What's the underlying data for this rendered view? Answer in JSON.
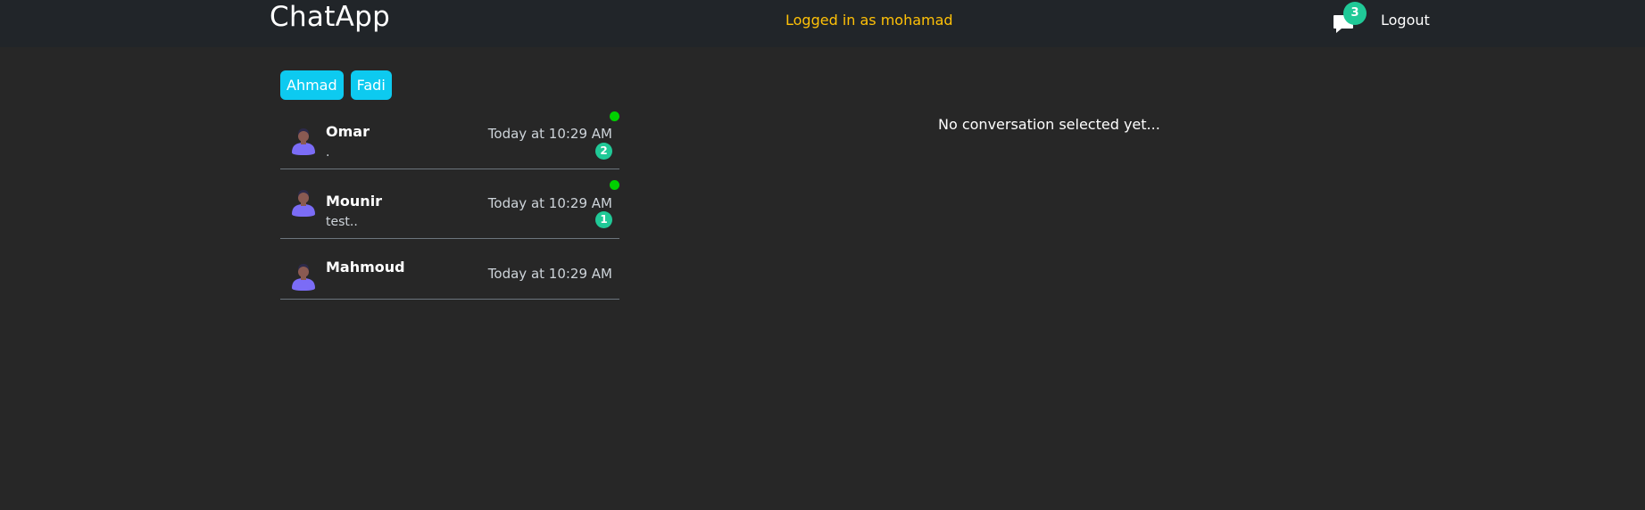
{
  "header": {
    "brand": "ChatApp",
    "logged_in_text": "Logged in as mohamad",
    "notification_count": "3",
    "logout_label": "Logout"
  },
  "contact_chips": [
    {
      "label": "Ahmad"
    },
    {
      "label": "Fadi"
    }
  ],
  "conversations": [
    {
      "name": "Omar",
      "preview": ".",
      "time": "Today at 10:29 AM",
      "unread": "2",
      "online": true
    },
    {
      "name": "Mounir",
      "preview": "test..",
      "time": "Today at 10:29 AM",
      "unread": "1",
      "online": true
    },
    {
      "name": "Mahmoud",
      "preview": "",
      "time": "Today at 10:29 AM",
      "unread": "",
      "online": false
    }
  ],
  "main": {
    "empty_state": "No conversation selected yet..."
  },
  "colors": {
    "background": "#272727",
    "navbar": "#212529",
    "accent_yellow": "#ffc107",
    "chip": "#0dcaf0",
    "badge": "#20c997",
    "online": "#00d100"
  },
  "icons": {
    "notifications": "chat-bubble-icon",
    "avatar": "user-avatar-icon"
  }
}
